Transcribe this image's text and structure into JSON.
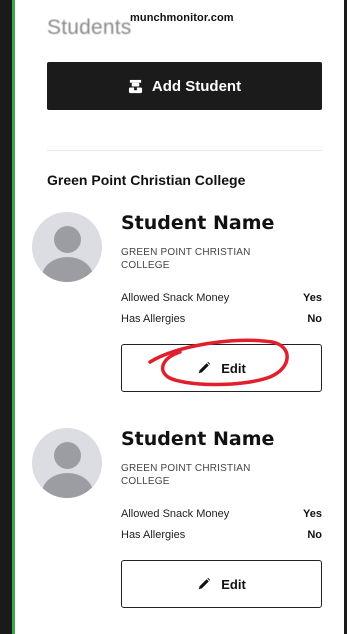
{
  "header": {
    "title": "Students",
    "watermark": "munchmonitor.com"
  },
  "actions": {
    "add_student_label": "Add Student",
    "add_student_icon": "student-icon"
  },
  "school_group": {
    "name": "Green Point Christian College"
  },
  "students": [
    {
      "name": "Student Name",
      "school": "GREEN POINT CHRISTIAN COLLEGE",
      "details": [
        {
          "label": "Allowed Snack Money",
          "value": "Yes"
        },
        {
          "label": "Has Allergies",
          "value": "No"
        }
      ],
      "edit_label": "Edit",
      "edit_icon": "pencil-icon"
    },
    {
      "name": "Student Name",
      "school": "GREEN POINT CHRISTIAN COLLEGE",
      "details": [
        {
          "label": "Allowed Snack Money",
          "value": "Yes"
        },
        {
          "label": "Has Allergies",
          "value": "No"
        }
      ],
      "edit_label": "Edit",
      "edit_icon": "pencil-icon"
    }
  ],
  "colors": {
    "frame_accent": "#3da64a",
    "primary_button": "#1b1b1b",
    "annotation_red": "#e0202a",
    "avatar_bg": "#dcdde3",
    "avatar_fg": "#9c9da3"
  }
}
